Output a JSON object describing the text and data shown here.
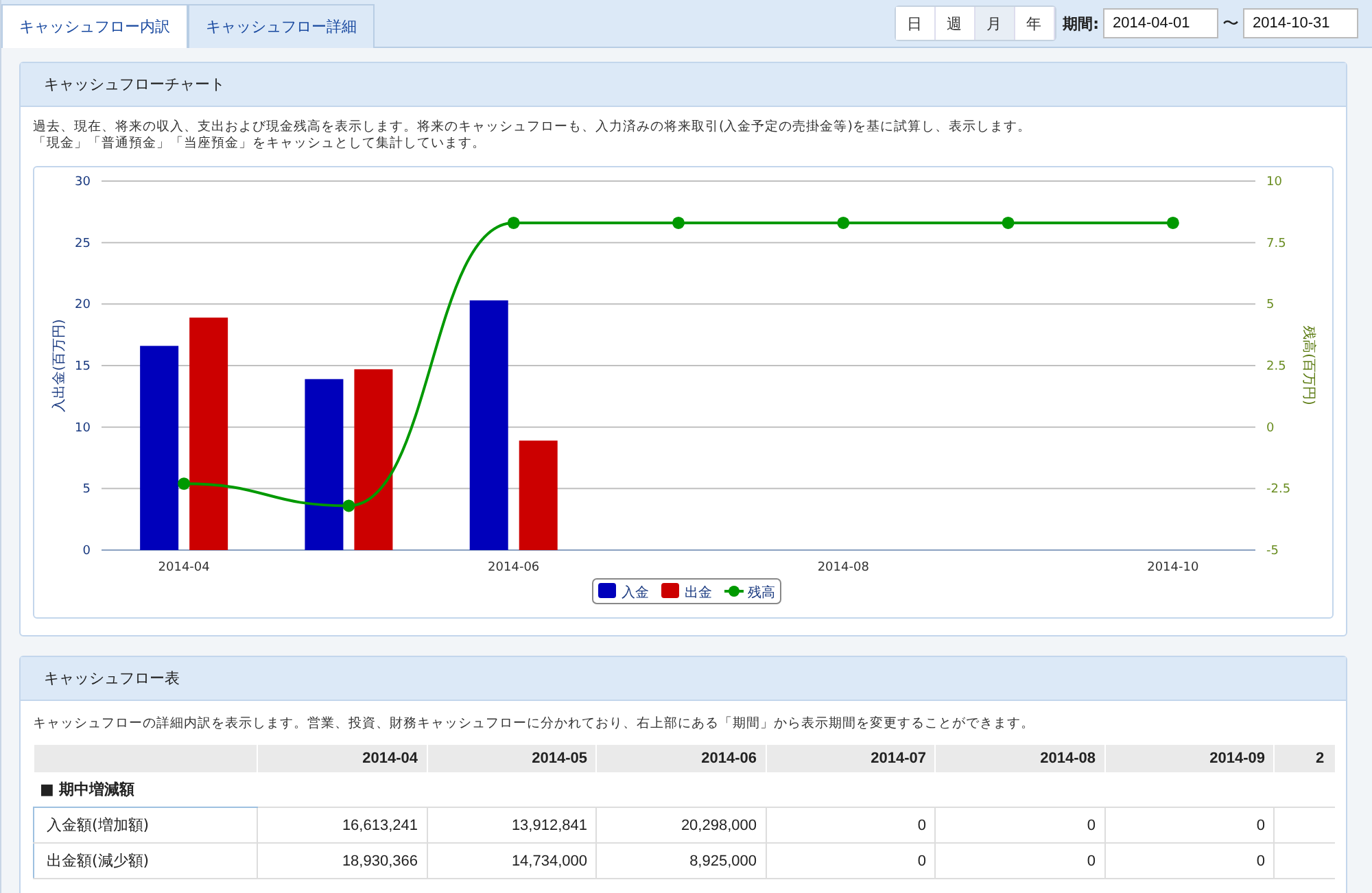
{
  "tabs": [
    {
      "label": "キャッシュフロー内訳",
      "selected": true
    },
    {
      "label": "キャッシュフロー詳細",
      "selected": false
    }
  ],
  "period_buttons": [
    {
      "label": "日",
      "selected": false
    },
    {
      "label": "週",
      "selected": false
    },
    {
      "label": "月",
      "selected": true
    },
    {
      "label": "年",
      "selected": false
    }
  ],
  "period_label": "期間:",
  "date_from": "2014-04-01",
  "date_separator": "〜",
  "date_to": "2014-10-31",
  "chart_panel": {
    "title": "キャッシュフローチャート",
    "description": [
      "過去、現在、将来の収入、支出および現金残高を表示します。将来のキャッシュフローも、入力済みの将来取引(入金予定の売掛金等)を基に試算し、表示します。",
      "「現金」「普通預金」「当座預金」をキャッシュとして集計しています。"
    ],
    "chart_data": {
      "type": "bar",
      "ylabel": "入出金(百万円)",
      "y2label": "残高(百万円)",
      "categories": [
        "2014-04",
        null,
        "2014-06",
        null,
        "2014-08",
        null,
        "2014-10"
      ],
      "grid": true,
      "legend": "bottom",
      "ylim": [
        0,
        30
      ],
      "yticks": [
        0,
        5,
        10,
        15,
        20,
        25,
        30
      ],
      "y2lim": [
        -5,
        10
      ],
      "y2ticks": [
        {
          "value": -5,
          "label": "-5"
        },
        {
          "value": -2.5,
          "label": "-2.5"
        },
        {
          "value": 0,
          "label": "0"
        },
        {
          "value": 2.5,
          "label": "2.5"
        },
        {
          "value": 5,
          "label": "5"
        },
        {
          "value": 7.5,
          "label": "7.5"
        },
        {
          "value": 10,
          "label": "10"
        }
      ],
      "series": [
        {
          "name": "入金",
          "color": "#0000bb",
          "values": [
            16.6,
            13.9,
            20.3,
            0,
            0,
            0,
            0
          ]
        },
        {
          "name": "出金",
          "color": "#cc0000",
          "values": [
            18.9,
            14.7,
            8.9,
            0,
            0,
            0,
            0
          ]
        },
        {
          "name": "残高",
          "color": "#009900",
          "type": "line",
          "axis": "y2",
          "marker": "circle",
          "values": [
            -2.3,
            -3.2,
            8.3,
            8.3,
            8.3,
            8.3,
            8.3
          ]
        }
      ]
    }
  },
  "table_panel": {
    "title": "キャッシュフロー表",
    "description": "キャッシュフローの詳細内訳を表示します。営業、投資、財務キャッシュフローに分かれており、右上部にある「期間」から表示期間を変更することができます。",
    "columns": [
      "2014-04",
      "2014-05",
      "2014-06",
      "2014-07",
      "2014-08",
      "2014-09",
      "2"
    ],
    "rows": [
      {
        "kind": "section",
        "label": "■ 期中増減額"
      },
      {
        "kind": "data",
        "label": "入金額(増加額)",
        "cells": [
          "16,613,241",
          "13,912,841",
          "20,298,000",
          "0",
          "0",
          "0"
        ]
      },
      {
        "kind": "data",
        "label": "出金額(減少額)",
        "cells": [
          "18,930,366",
          "14,734,000",
          "8,925,000",
          "0",
          "0",
          "0"
        ]
      }
    ]
  }
}
